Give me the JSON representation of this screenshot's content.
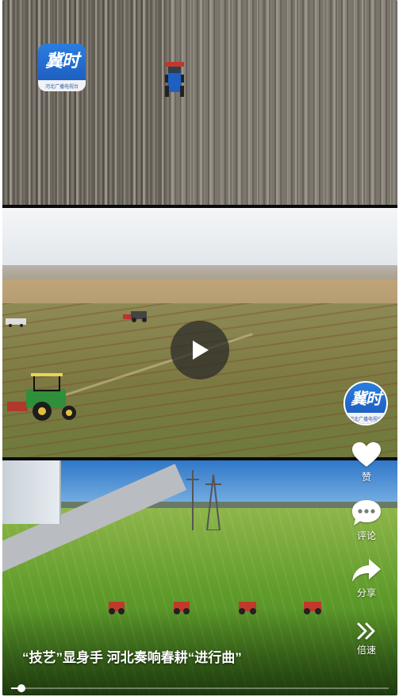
{
  "logo": {
    "name": "冀时",
    "strip": "河北广播电视台"
  },
  "video": {
    "caption": "“技艺”显身手 河北奏响春耕“进行曲”",
    "progress": 0.02
  },
  "actions": {
    "like_label": "赞",
    "comment_label": "评论",
    "share_label": "分享",
    "speed_label": "倍速"
  },
  "icons": [
    "play-icon",
    "heart-icon",
    "comment-icon",
    "share-icon",
    "speed-icon"
  ],
  "colors": {
    "accent": "#2b7de0",
    "overlay_text": "#ffffff"
  }
}
